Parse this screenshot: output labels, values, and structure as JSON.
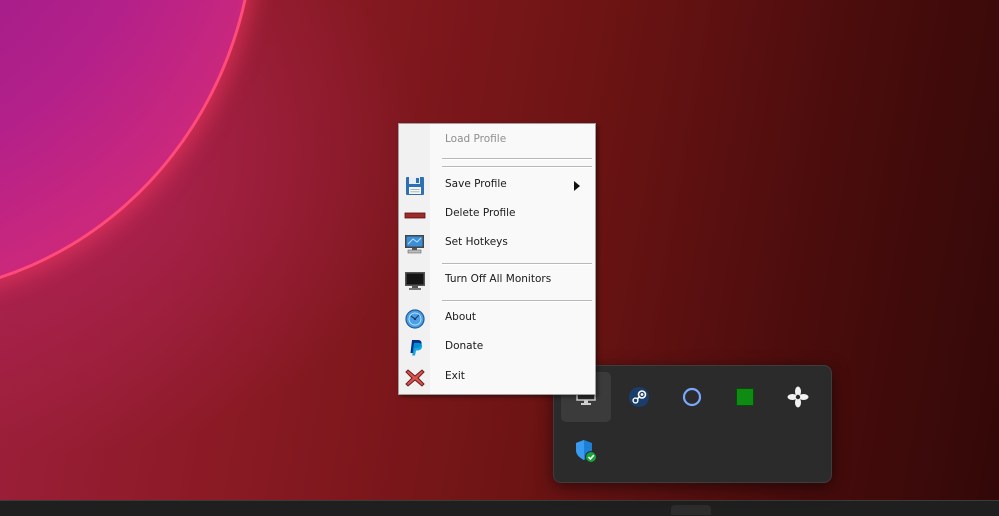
{
  "context_menu": {
    "items": [
      {
        "label": "Load Profile",
        "icon": "none",
        "disabled": true
      },
      {
        "label": "Save Profile",
        "icon": "floppy-disk-icon",
        "submenu": true
      },
      {
        "label": "Delete Profile",
        "icon": "delete-bar-icon"
      },
      {
        "label": "Set Hotkeys",
        "icon": "monitor-keyboard-icon"
      },
      {
        "label": "Turn Off All Monitors",
        "icon": "monitor-off-icon"
      },
      {
        "label": "About",
        "icon": "globe-info-icon"
      },
      {
        "label": "Donate",
        "icon": "paypal-icon"
      },
      {
        "label": "Exit",
        "icon": "red-x-icon"
      }
    ]
  },
  "tray_overflow": {
    "icons": [
      "monitor-icon",
      "steam-icon",
      "cortana-ring-icon",
      "green-square-icon",
      "fan-icon",
      "windows-security-icon"
    ]
  },
  "colors": {
    "menu_bg": "#f9f9f9",
    "tray_bg": "#2b2b2b",
    "disabled_text": "#8e8e8e"
  }
}
